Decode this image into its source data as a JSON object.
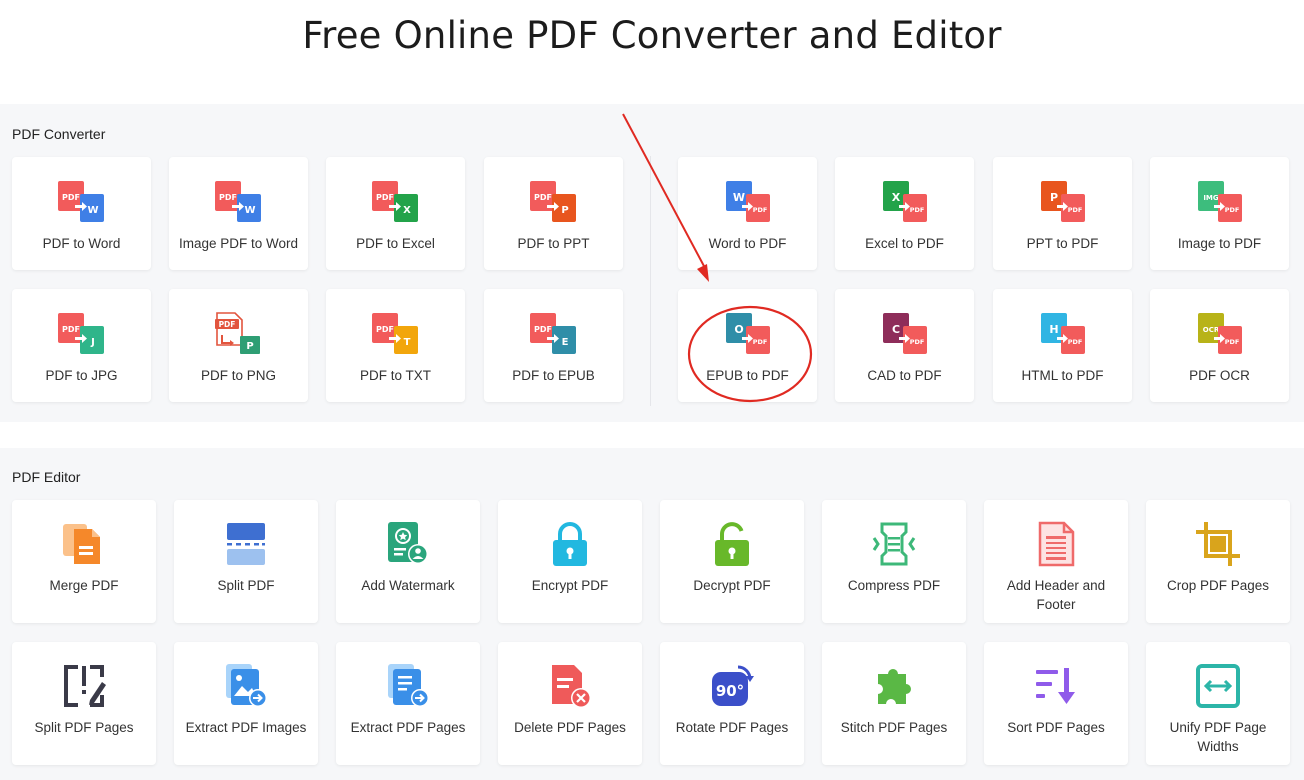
{
  "page": {
    "title": "Free Online PDF Converter and Editor"
  },
  "converter": {
    "title": "PDF Converter",
    "items": [
      {
        "label": "PDF to Word",
        "icon": "pdf-to-word-icon"
      },
      {
        "label": "Image PDF to Word",
        "icon": "image-pdf-to-word-icon"
      },
      {
        "label": "PDF to Excel",
        "icon": "pdf-to-excel-icon"
      },
      {
        "label": "PDF to PPT",
        "icon": "pdf-to-ppt-icon"
      },
      {
        "label": "Word to PDF",
        "icon": "word-to-pdf-icon"
      },
      {
        "label": "Excel to PDF",
        "icon": "excel-to-pdf-icon"
      },
      {
        "label": "PPT to PDF",
        "icon": "ppt-to-pdf-icon"
      },
      {
        "label": "Image to PDF",
        "icon": "image-to-pdf-icon"
      },
      {
        "label": "PDF to JPG",
        "icon": "pdf-to-jpg-icon"
      },
      {
        "label": "PDF to PNG",
        "icon": "pdf-to-png-icon"
      },
      {
        "label": "PDF to TXT",
        "icon": "pdf-to-txt-icon"
      },
      {
        "label": "PDF to EPUB",
        "icon": "pdf-to-epub-icon"
      },
      {
        "label": "EPUB to PDF",
        "icon": "epub-to-pdf-icon"
      },
      {
        "label": "CAD to PDF",
        "icon": "cad-to-pdf-icon"
      },
      {
        "label": "HTML to PDF",
        "icon": "html-to-pdf-icon"
      },
      {
        "label": "PDF OCR",
        "icon": "pdf-ocr-icon"
      }
    ],
    "icon_text": {
      "pdf": "PDF",
      "word": "W",
      "excel": "X",
      "ppt": "P",
      "img": "IMG",
      "jpg": "J",
      "png": "P",
      "txt": "T",
      "epub": "E",
      "epub_src": "O",
      "cad": "C",
      "html": "H",
      "ocr": "OCR"
    }
  },
  "editor": {
    "title": "PDF Editor",
    "items": [
      {
        "label": "Merge PDF",
        "icon": "merge-icon"
      },
      {
        "label": "Split PDF",
        "icon": "split-icon"
      },
      {
        "label": "Add Watermark",
        "icon": "watermark-icon"
      },
      {
        "label": "Encrypt PDF",
        "icon": "lock-icon"
      },
      {
        "label": "Decrypt PDF",
        "icon": "unlock-icon"
      },
      {
        "label": "Compress PDF",
        "icon": "compress-icon"
      },
      {
        "label": "Add Header and Footer",
        "icon": "header-footer-icon"
      },
      {
        "label": "Crop PDF Pages",
        "icon": "crop-icon"
      },
      {
        "label": "Split PDF Pages",
        "icon": "split-pages-icon"
      },
      {
        "label": "Extract PDF Images",
        "icon": "extract-images-icon"
      },
      {
        "label": "Extract PDF Pages",
        "icon": "extract-pages-icon"
      },
      {
        "label": "Delete PDF Pages",
        "icon": "delete-pages-icon"
      },
      {
        "label": "Rotate PDF Pages",
        "icon": "rotate-icon"
      },
      {
        "label": "Stitch PDF Pages",
        "icon": "puzzle-icon"
      },
      {
        "label": "Sort PDF Pages",
        "icon": "sort-icon"
      },
      {
        "label": "Unify PDF Page Widths",
        "icon": "unify-width-icon"
      }
    ],
    "rotate_text": "90°"
  },
  "colors": {
    "pdf_red": "#f25b5b",
    "word_blue": "#3f7fe6",
    "excel_green": "#23a34a",
    "ppt_orange": "#e8551e",
    "img_green": "#3dbd7d",
    "jpg_teal": "#2fb58a",
    "png_green": "#2e9e74",
    "txt_yellow": "#f2a60c",
    "epub_teal": "#2f8ea8",
    "cad_plum": "#8e2d5a",
    "html_cyan": "#30b5e3",
    "ocr_olive": "#b8b318",
    "annotation_red": "#e02a22"
  }
}
